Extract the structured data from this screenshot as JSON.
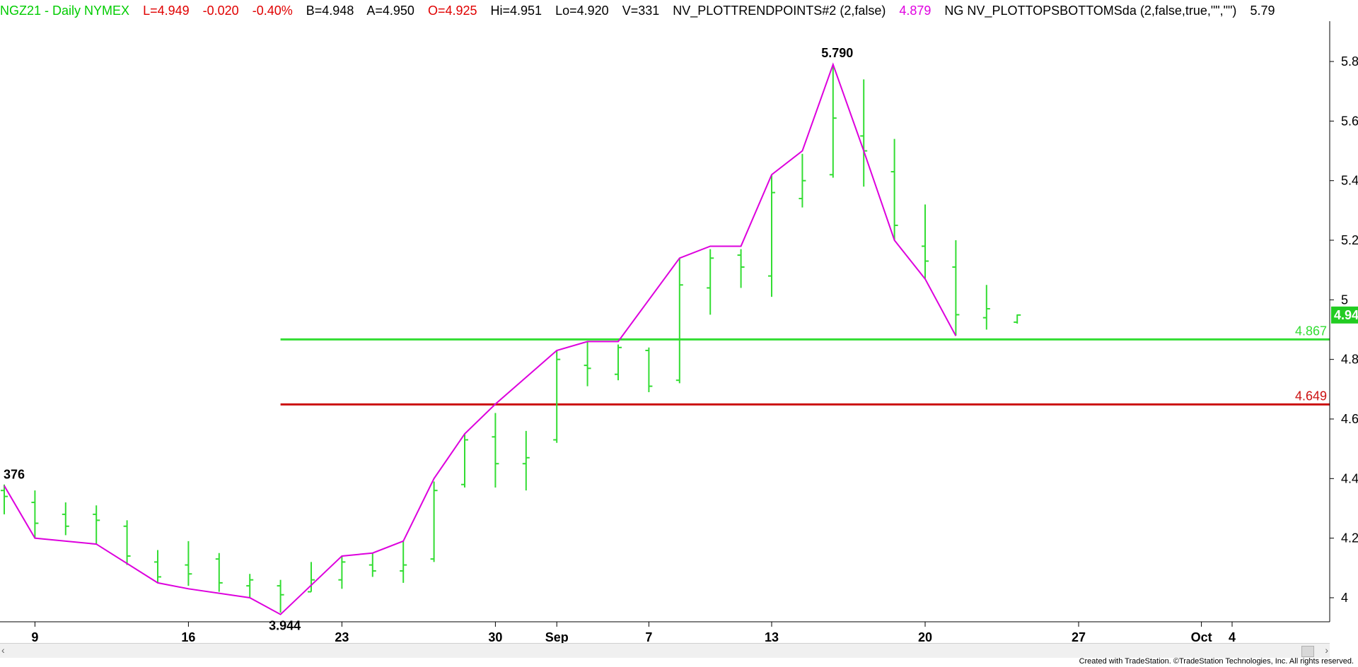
{
  "header": {
    "title": "NGZ21 - Daily  NYMEX",
    "last": "L=4.949",
    "change": "-0.020",
    "pct": "-0.40%",
    "bid": "B=4.948",
    "ask": "A=4.950",
    "open": "O=4.925",
    "high": "Hi=4.951",
    "low": "Lo=4.920",
    "volume": "V=331",
    "indicator1": "NV_PLOTTRENDPOINTS#2 (2,false)",
    "indicator1_value": "4.879",
    "indicator2": "NG NV_PLOTTOPSBOTTOMSda (2,false,true,\"\",\"\")",
    "indicator2_value": "5.79"
  },
  "footer": {
    "credit": "Created with TradeStation. ©TradeStation Technologies, Inc. All rights reserved."
  },
  "chart_data": {
    "type": "bar",
    "y_ticks": [
      "4",
      "4.2",
      "4.4",
      "4.6",
      "4.8",
      "5",
      "5.2",
      "5.4",
      "5.6",
      "5.8"
    ],
    "ylim": [
      3.86,
      5.94
    ],
    "x_ticks": [
      {
        "label": "9",
        "i": 1
      },
      {
        "label": "16",
        "i": 6
      },
      {
        "label": "23",
        "i": 11
      },
      {
        "label": "30",
        "i": 16
      },
      {
        "label": "Sep",
        "i": 18
      },
      {
        "label": "7",
        "i": 21
      },
      {
        "label": "13",
        "i": 25
      },
      {
        "label": "20",
        "i": 30
      },
      {
        "label": "27",
        "i": 35
      },
      {
        "label": "Oct",
        "i": 39
      },
      {
        "label": "4",
        "i": 40
      }
    ],
    "bars": [
      {
        "o": 4.36,
        "h": 4.38,
        "l": 4.28,
        "c": 4.34
      },
      {
        "o": 4.32,
        "h": 4.36,
        "l": 4.2,
        "c": 4.25
      },
      {
        "o": 4.28,
        "h": 4.32,
        "l": 4.21,
        "c": 4.24
      },
      {
        "o": 4.28,
        "h": 4.31,
        "l": 4.18,
        "c": 4.26
      },
      {
        "o": 4.24,
        "h": 4.26,
        "l": 4.11,
        "c": 4.14
      },
      {
        "o": 4.12,
        "h": 4.16,
        "l": 4.05,
        "c": 4.07
      },
      {
        "o": 4.11,
        "h": 4.19,
        "l": 4.04,
        "c": 4.08
      },
      {
        "o": 4.13,
        "h": 4.15,
        "l": 4.02,
        "c": 4.05
      },
      {
        "o": 4.04,
        "h": 4.08,
        "l": 4.0,
        "c": 4.06
      },
      {
        "o": 4.04,
        "h": 4.06,
        "l": 3.95,
        "c": 4.01
      },
      {
        "o": 4.02,
        "h": 4.12,
        "l": 4.02,
        "c": 4.06
      },
      {
        "o": 4.06,
        "h": 4.14,
        "l": 4.03,
        "c": 4.12
      },
      {
        "o": 4.11,
        "h": 4.15,
        "l": 4.07,
        "c": 4.09
      },
      {
        "o": 4.09,
        "h": 4.19,
        "l": 4.05,
        "c": 4.11
      },
      {
        "o": 4.13,
        "h": 4.39,
        "l": 4.12,
        "c": 4.36
      },
      {
        "o": 4.38,
        "h": 4.55,
        "l": 4.37,
        "c": 4.53
      },
      {
        "o": 4.54,
        "h": 4.62,
        "l": 4.37,
        "c": 4.45
      },
      {
        "o": 4.45,
        "h": 4.56,
        "l": 4.36,
        "c": 4.47
      },
      {
        "o": 4.53,
        "h": 4.83,
        "l": 4.52,
        "c": 4.8
      },
      {
        "o": 4.78,
        "h": 4.86,
        "l": 4.71,
        "c": 4.77
      },
      {
        "o": 4.75,
        "h": 4.85,
        "l": 4.73,
        "c": 4.84
      },
      {
        "o": 4.83,
        "h": 4.84,
        "l": 4.69,
        "c": 4.71
      },
      {
        "o": 4.73,
        "h": 5.14,
        "l": 4.72,
        "c": 5.05
      },
      {
        "o": 5.04,
        "h": 5.17,
        "l": 4.95,
        "c": 5.14
      },
      {
        "o": 5.15,
        "h": 5.17,
        "l": 5.04,
        "c": 5.11
      },
      {
        "o": 5.08,
        "h": 5.42,
        "l": 5.01,
        "c": 5.36
      },
      {
        "o": 5.34,
        "h": 5.49,
        "l": 5.31,
        "c": 5.4
      },
      {
        "o": 5.42,
        "h": 5.79,
        "l": 5.41,
        "c": 5.61
      },
      {
        "o": 5.55,
        "h": 5.74,
        "l": 5.38,
        "c": 5.5
      },
      {
        "o": 5.43,
        "h": 5.54,
        "l": 5.2,
        "c": 5.25
      },
      {
        "o": 5.18,
        "h": 5.32,
        "l": 5.07,
        "c": 5.13
      },
      {
        "o": 5.11,
        "h": 5.2,
        "l": 4.88,
        "c": 4.95
      },
      {
        "o": 4.94,
        "h": 5.05,
        "l": 4.9,
        "c": 4.97
      },
      {
        "o": 4.925,
        "h": 4.951,
        "l": 4.92,
        "c": 4.949
      }
    ],
    "trend_points": [
      {
        "i": 0,
        "v": 4.376
      },
      {
        "i": 1,
        "v": 4.2
      },
      {
        "i": 3,
        "v": 4.18
      },
      {
        "i": 5,
        "v": 4.05
      },
      {
        "i": 6,
        "v": 4.03
      },
      {
        "i": 8,
        "v": 4.0
      },
      {
        "i": 9,
        "v": 3.944
      },
      {
        "i": 11,
        "v": 4.14
      },
      {
        "i": 12,
        "v": 4.15
      },
      {
        "i": 13,
        "v": 4.19
      },
      {
        "i": 14,
        "v": 4.4
      },
      {
        "i": 15,
        "v": 4.55
      },
      {
        "i": 16,
        "v": 4.65
      },
      {
        "i": 18,
        "v": 4.83
      },
      {
        "i": 19,
        "v": 4.86
      },
      {
        "i": 20,
        "v": 4.86
      },
      {
        "i": 22,
        "v": 5.14
      },
      {
        "i": 23,
        "v": 5.18
      },
      {
        "i": 24,
        "v": 5.18
      },
      {
        "i": 25,
        "v": 5.42
      },
      {
        "i": 26,
        "v": 5.5
      },
      {
        "i": 27,
        "v": 5.79
      },
      {
        "i": 28,
        "v": 5.5
      },
      {
        "i": 29,
        "v": 5.2
      },
      {
        "i": 30,
        "v": 5.07
      },
      {
        "i": 31,
        "v": 4.879
      }
    ],
    "swing_labels": [
      {
        "text": "376",
        "i": 0,
        "v": 4.376,
        "pos": "above"
      },
      {
        "text": "3.944",
        "i": 9,
        "v": 3.944,
        "pos": "below"
      },
      {
        "text": "5.790",
        "i": 27,
        "v": 5.79,
        "pos": "above"
      }
    ],
    "hlines": [
      {
        "value": 4.867,
        "label": "4.867",
        "color": "#33dd33",
        "from_i": 9
      },
      {
        "value": 4.649,
        "label": "4.649",
        "color": "#cc1111",
        "from_i": 9
      }
    ],
    "last_price_marker": "4.94",
    "colors": {
      "bars": "#33dd33",
      "trend": "#dd00dd",
      "axis": "#000000"
    }
  }
}
